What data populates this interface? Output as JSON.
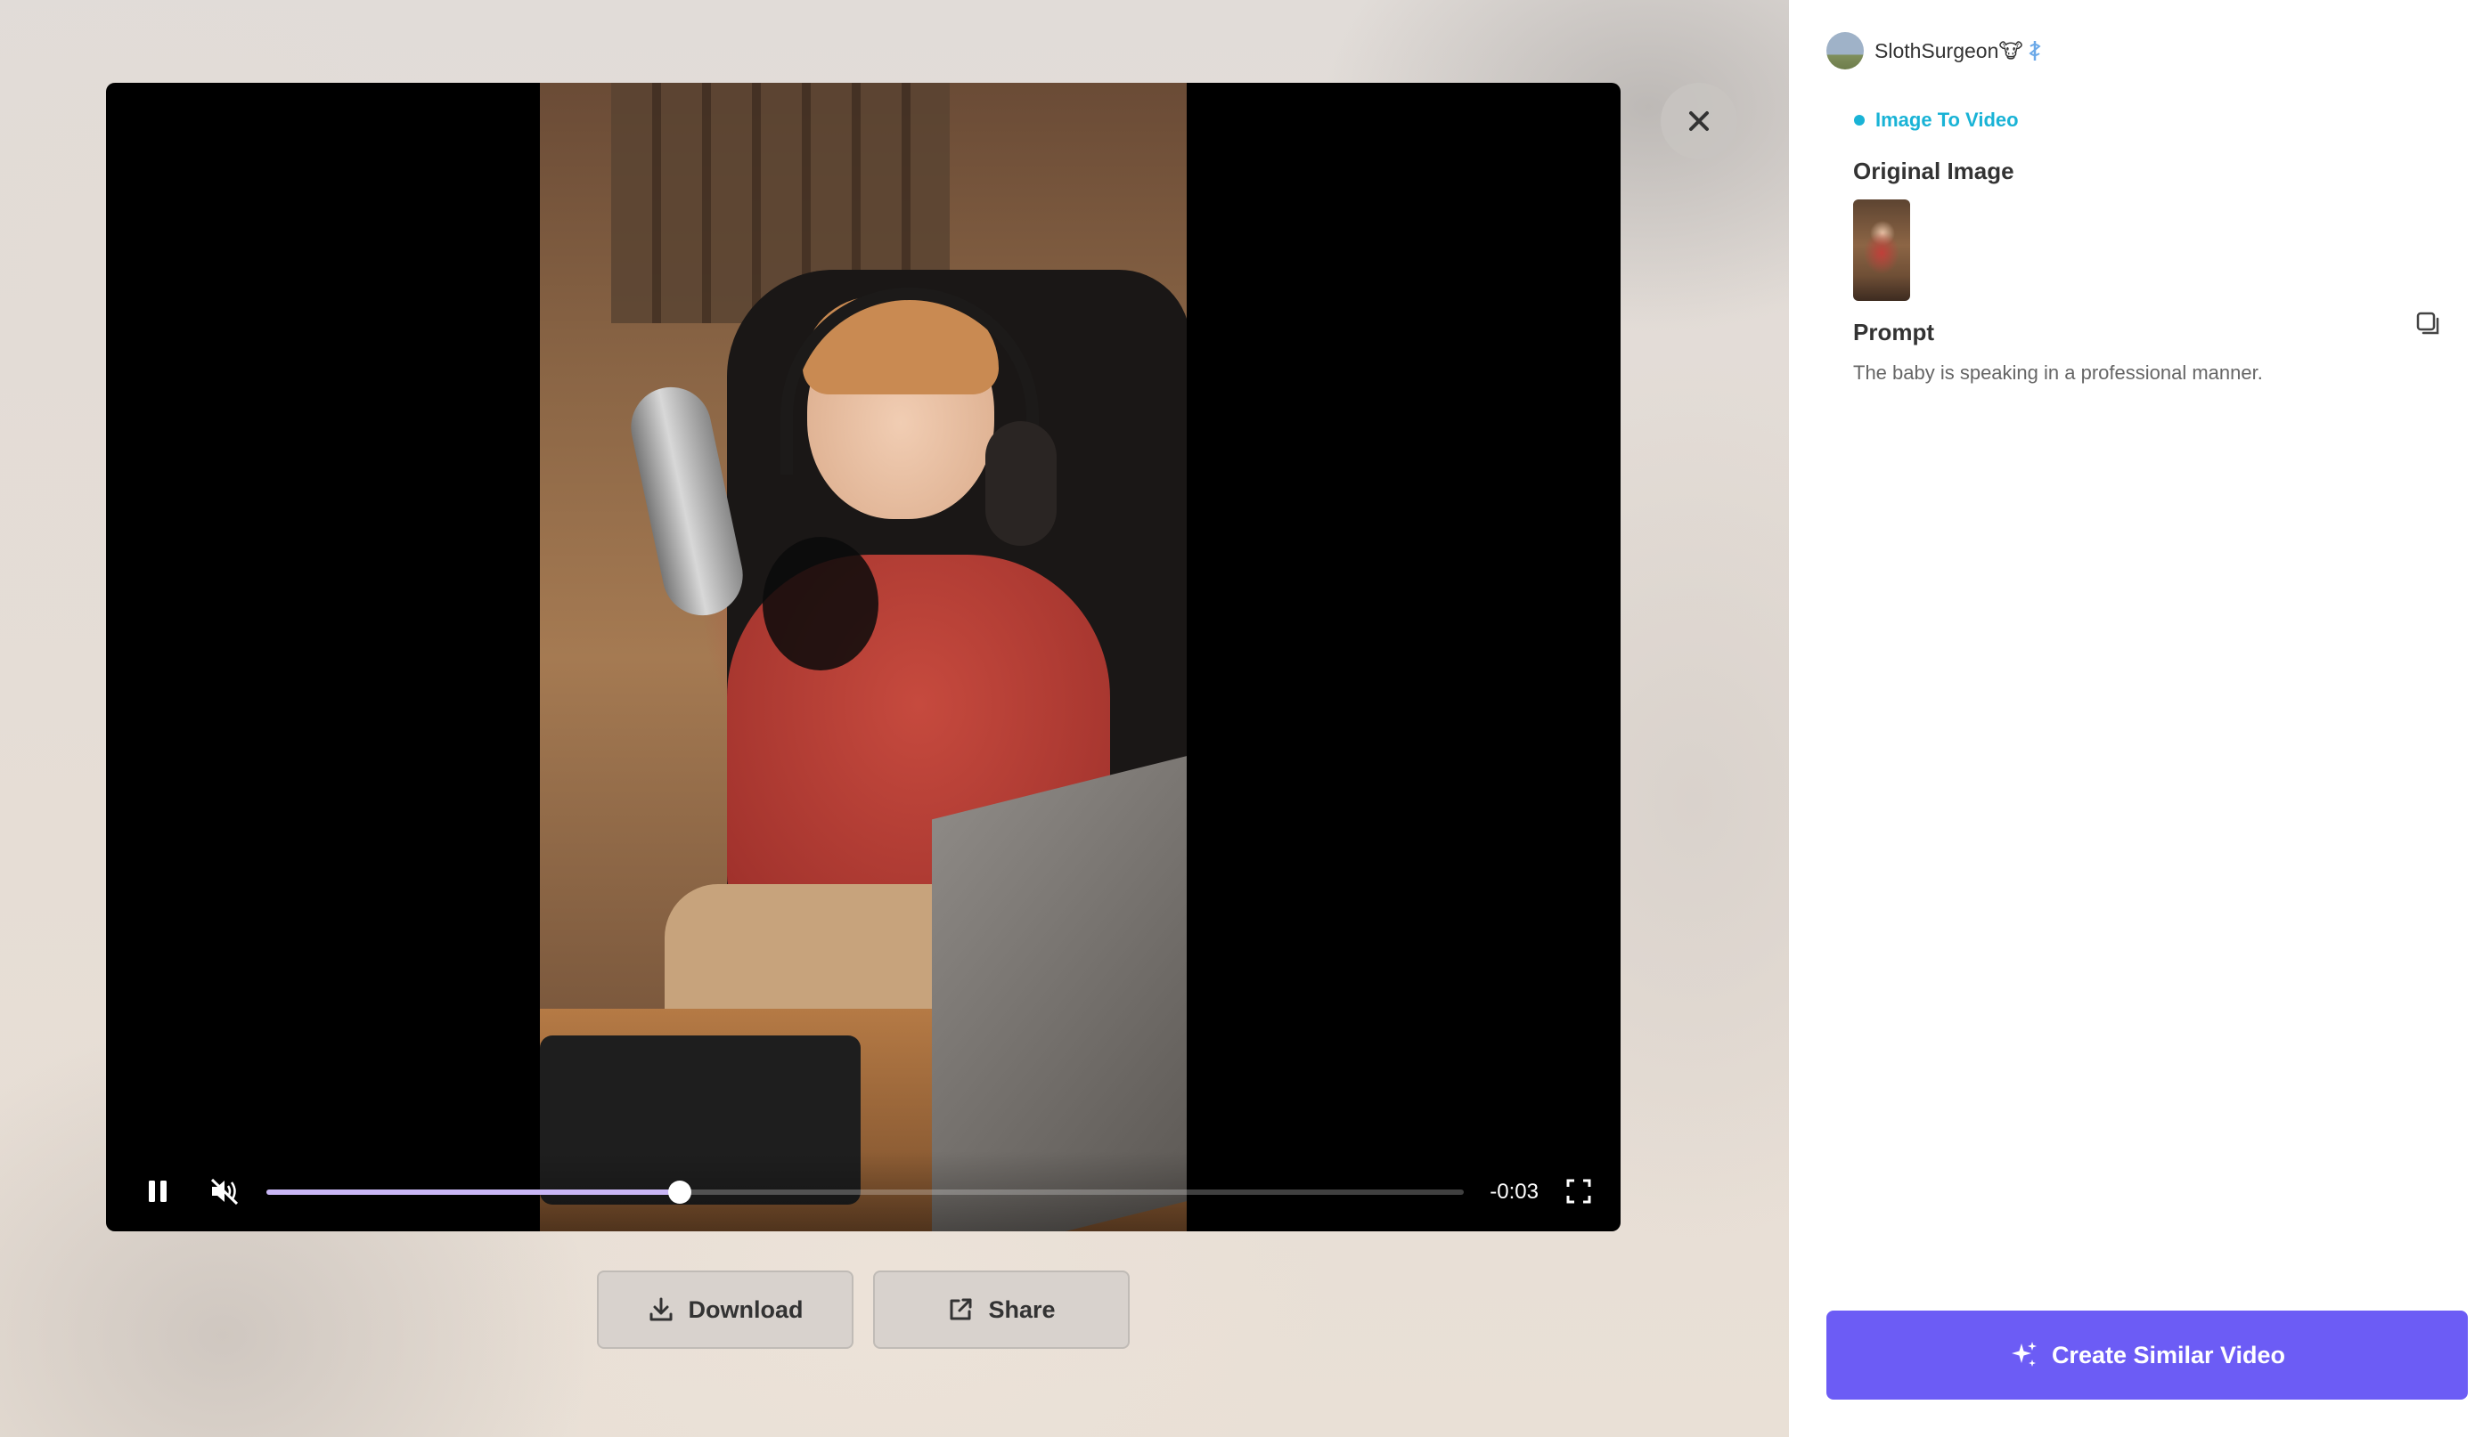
{
  "player": {
    "time_remaining": "-0:03",
    "progress": 0.345
  },
  "actions": {
    "download_label": "Download",
    "share_label": "Share"
  },
  "panel": {
    "username": "SlothSurgeon",
    "username_emoji": "🐮",
    "tag_label": "Image To Video",
    "original_image_title": "Original Image",
    "prompt_title": "Prompt",
    "prompt_text": "The baby is speaking in a professional manner.",
    "create_button_label": "Create Similar Video"
  },
  "colors": {
    "accent": "#6c5cf5",
    "tag": "#19b3d6",
    "progress": "#c9b6f5"
  },
  "icons": {
    "pause": "pause-icon",
    "mute": "volume-muted-icon",
    "fullscreen": "fullscreen-icon",
    "close": "close-icon",
    "download": "download-icon",
    "share": "share-icon",
    "copy": "copy-icon",
    "sparkle": "sparkle-icon",
    "badge": "medical-badge-icon"
  }
}
